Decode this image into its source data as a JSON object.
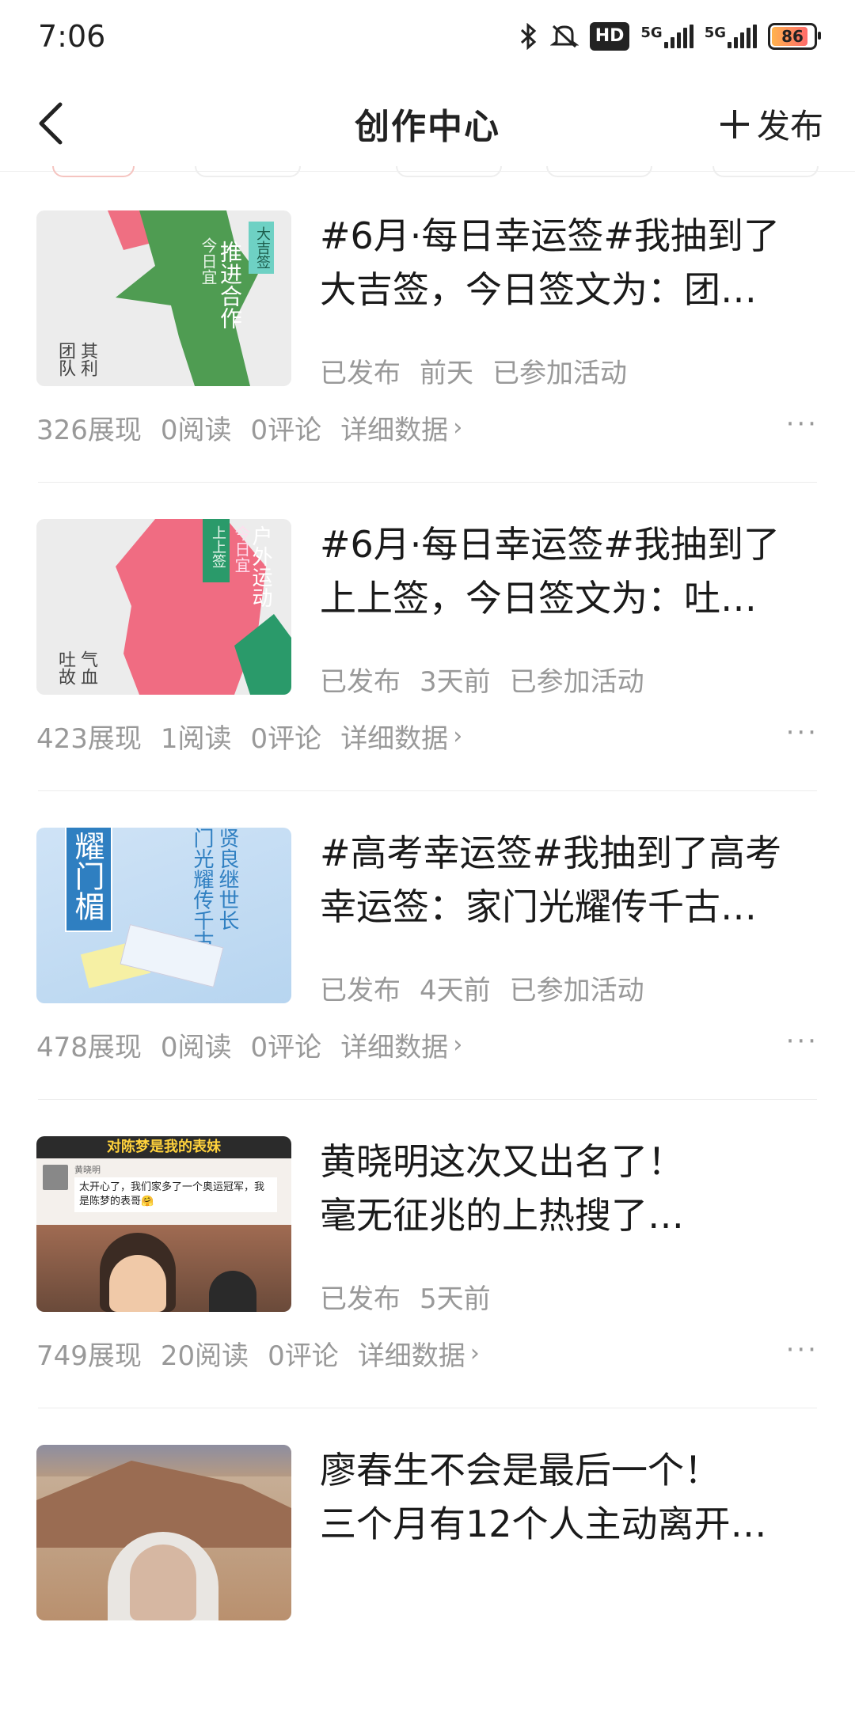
{
  "status_bar": {
    "time": "7:06",
    "hd": "HD",
    "net1": "5G",
    "net2": "5G",
    "battery": "86",
    "icons": [
      "bluetooth-icon",
      "mute-icon",
      "hd-icon",
      "signal-icon",
      "signal-icon",
      "battery-icon"
    ]
  },
  "nav": {
    "title": "创作中心",
    "publish_label": "发布",
    "back_icon": "chevron-left-icon",
    "publish_icon": "plus-icon"
  },
  "articles": [
    {
      "title_line1": "#6月·每日幸运签#我抽到了",
      "title_line2": "大吉签，今日签文为：团…",
      "status": "已发布",
      "time": "前天",
      "activity": "已参加活动",
      "views": "326展现",
      "reads": "0阅读",
      "comments": "0评论",
      "detail": "详细数据",
      "more": "···",
      "thumb": {
        "tag": "大吉签",
        "main": "推进合作",
        "sub": "今日宜",
        "corner": "其利团队"
      }
    },
    {
      "title_line1": "#6月·每日幸运签#我抽到了",
      "title_line2": "上上签，今日签文为：吐…",
      "status": "已发布",
      "time": "3天前",
      "activity": "已参加活动",
      "views": "423展现",
      "reads": "1阅读",
      "comments": "0评论",
      "detail": "详细数据",
      "more": "···",
      "thumb": {
        "tag": "上上签",
        "main": "户外运动",
        "sub": "今日宜",
        "corner": "气血吐故"
      }
    },
    {
      "title_line1": "#高考幸运签#我抽到了高考",
      "title_line2": "幸运签：家门光耀传千古…",
      "status": "已发布",
      "time": "4天前",
      "activity": "已参加活动",
      "views": "478展现",
      "reads": "0阅读",
      "comments": "0评论",
      "detail": "详细数据",
      "more": "···",
      "thumb": {
        "main": "耀门楣",
        "col1": "门光耀传千古",
        "col2": "贤良继世长"
      }
    },
    {
      "title_line1": "黄晓明这次又出名了！",
      "title_line2": "毫无征兆的上热搜了…",
      "status": "已发布",
      "time": "5天前",
      "activity": "",
      "views": "749展现",
      "reads": "20阅读",
      "comments": "0评论",
      "detail": "详细数据",
      "more": "···",
      "thumb": {
        "banner": "对陈梦是我的表妹",
        "name": "黄晓明",
        "quote": "太开心了，我们家多了一个奥运冠军，我是陈梦的表哥🤗"
      }
    },
    {
      "title_line1": "廖春生不会是最后一个！",
      "title_line2": "三个月有12个人主动离开…",
      "status": "",
      "time": "",
      "activity": "",
      "views": "",
      "reads": "",
      "comments": "",
      "detail": "",
      "more": "",
      "thumb": {}
    }
  ]
}
